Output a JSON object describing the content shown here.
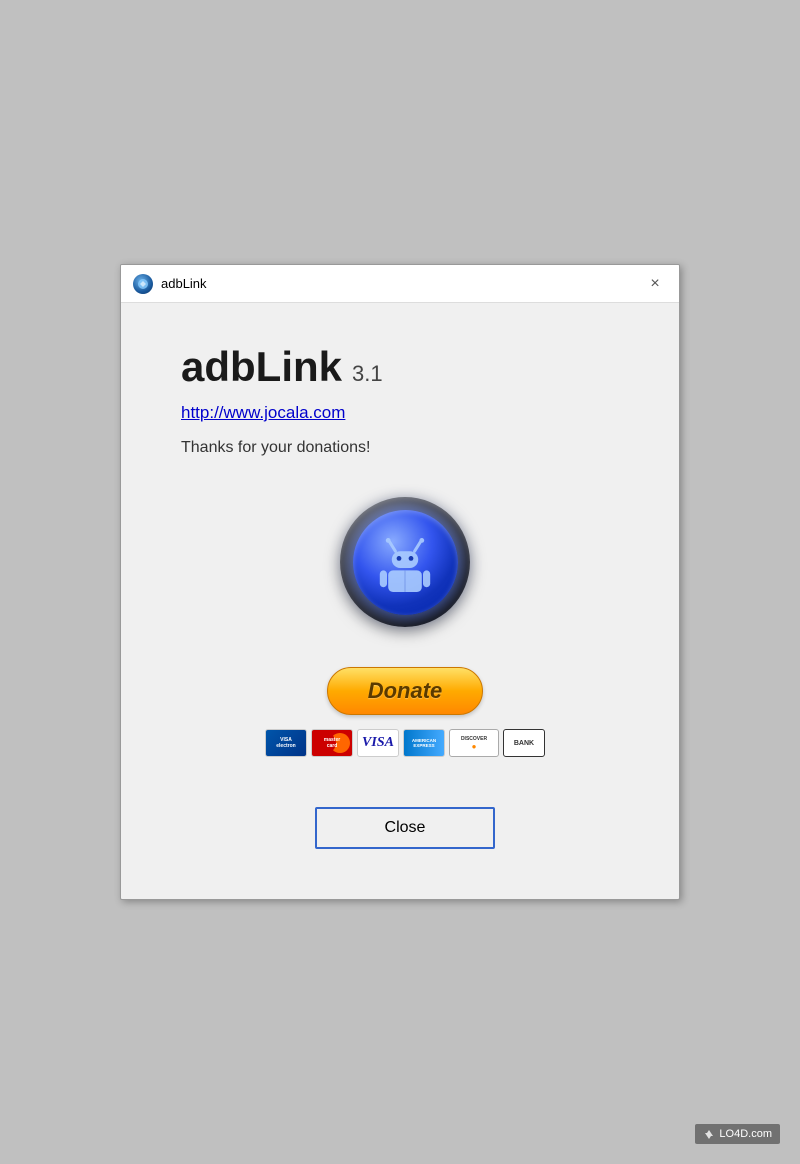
{
  "window": {
    "title": "adbLink",
    "close_label": "×"
  },
  "app": {
    "name": "adbLink",
    "version": "3.1",
    "website": "http://www.jocala.com",
    "thanks_text": "Thanks for your donations!"
  },
  "donate_button": {
    "label": "Donate"
  },
  "close_button": {
    "label": "Close"
  },
  "payment_cards": [
    {
      "id": "electro",
      "label": "ELECTRON"
    },
    {
      "id": "mastercard",
      "label": "mastercard"
    },
    {
      "id": "visa",
      "label": "VISA"
    },
    {
      "id": "amex",
      "label": "AMERICAN EXPRESS"
    },
    {
      "id": "discover",
      "label": "DISCOVER"
    },
    {
      "id": "bank",
      "label": "BANK"
    }
  ],
  "watermark": {
    "text": "LO4D.com"
  }
}
